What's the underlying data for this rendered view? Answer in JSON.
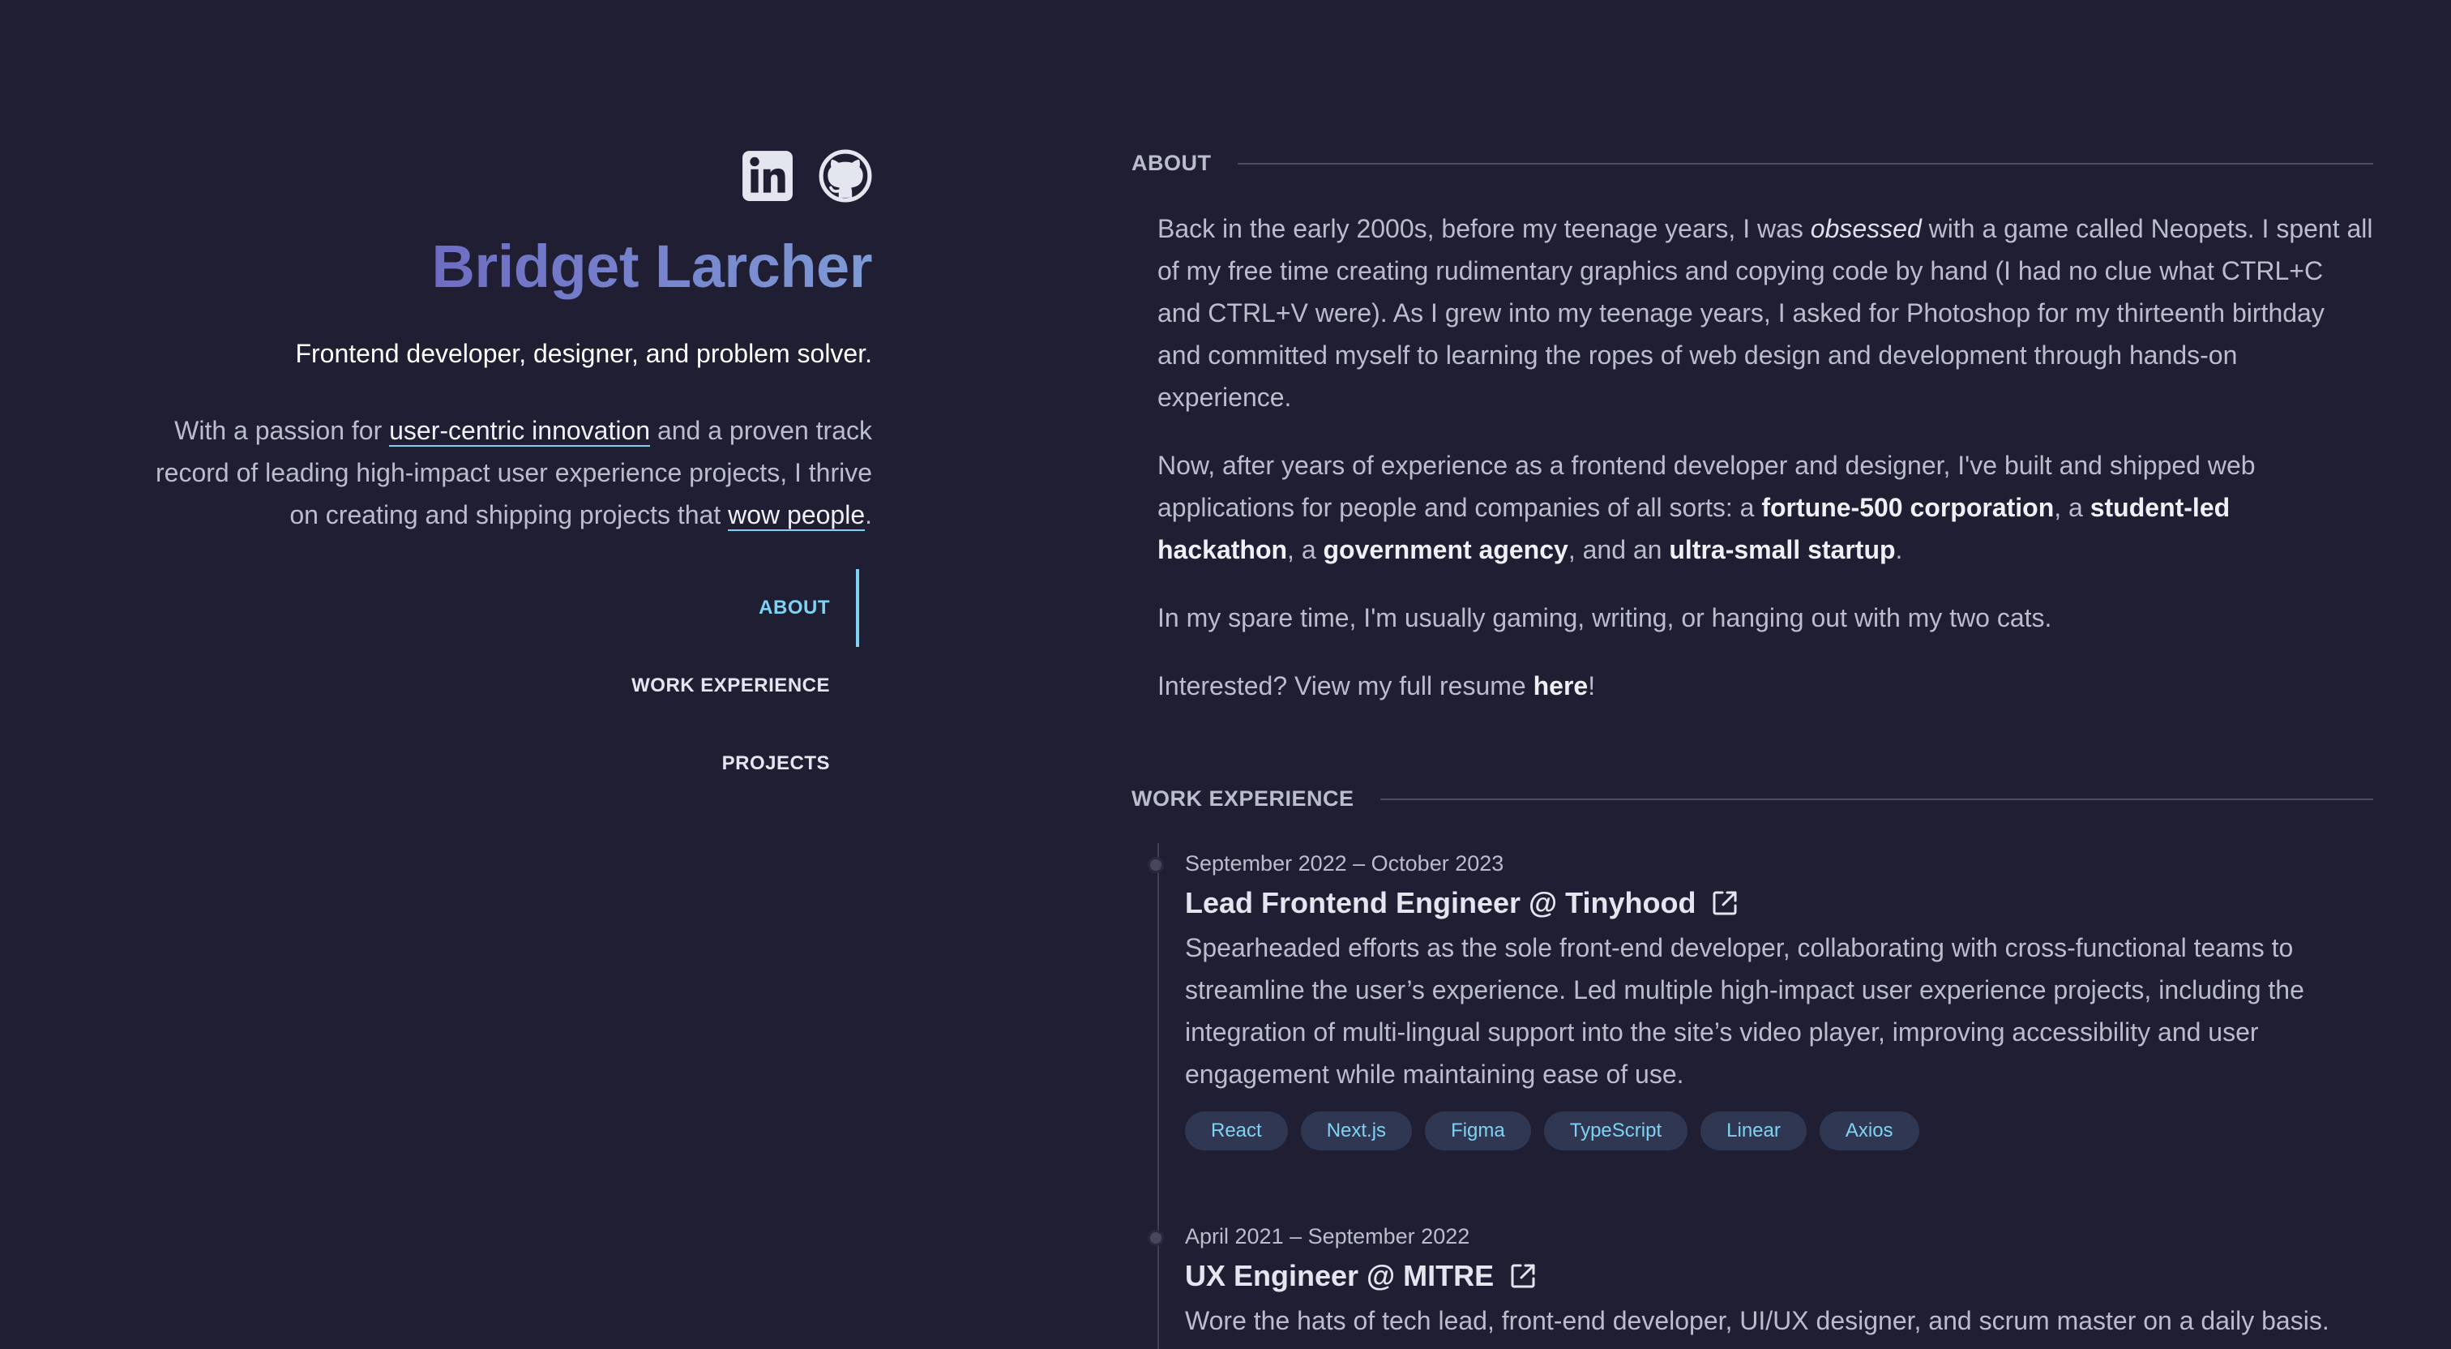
{
  "profile": {
    "name": "Bridget Larcher",
    "tagline": "Frontend developer, designer, and problem solver.",
    "intro": {
      "part1": "With a passion for ",
      "link1": "user-centric innovation",
      "part2": " and a proven track record of leading high-impact user experience projects, I thrive on creating and shipping projects that ",
      "link2": "wow people",
      "part3": "."
    },
    "socials": [
      {
        "icon": "linkedin-icon"
      },
      {
        "icon": "github-icon"
      }
    ]
  },
  "nav": [
    {
      "label": "ABOUT",
      "active": true
    },
    {
      "label": "WORK EXPERIENCE",
      "active": false
    },
    {
      "label": "PROJECTS",
      "active": false
    }
  ],
  "about": {
    "heading": "ABOUT",
    "p1": {
      "a": "Back in the early 2000s, before my teenage years, I was ",
      "em": "obsessed",
      "b": " with a game called Neopets. I spent all of my free time creating rudimentary graphics and copying code by hand (I had no clue what CTRL+C and CTRL+V were). As I grew into my teenage years, I asked for Photoshop for my thirteenth birthday and committed myself to learning the ropes of web design and development through hands-on experience."
    },
    "p2": {
      "a": "Now, after years of experience as a frontend developer and designer, I've built and shipped web applications for people and companies of all sorts: a ",
      "s1": "fortune-500 corporation",
      "b": ", a ",
      "s2": "student-led hackathon",
      "c": ", a ",
      "s3": "government agency",
      "d": ", and an ",
      "s4": "ultra-small startup",
      "e": "."
    },
    "p3": "In my spare time, I'm usually gaming, writing, or hanging out with my two cats.",
    "p4": {
      "a": "Interested? View my full resume ",
      "link": "here",
      "b": "!"
    }
  },
  "experience": {
    "heading": "WORK EXPERIENCE",
    "jobs": [
      {
        "dates": "September 2022 – October 2023",
        "title": "Lead Frontend Engineer @ Tinyhood",
        "description": "Spearheaded efforts as the sole front-end developer, collaborating with cross-functional teams to streamline the user’s experience. Led multiple high-impact user experience projects, including the integration of multi-lingual support into the site’s video player, improving accessibility and user engagement while maintaining ease of use.",
        "tags": [
          "React",
          "Next.js",
          "Figma",
          "TypeScript",
          "Linear",
          "Axios"
        ]
      },
      {
        "dates": "April 2021 – September 2022",
        "title": "UX Engineer @ MITRE",
        "description": "Wore the hats of tech lead, front-end developer, UI/UX designer, and scrum master on a daily basis.",
        "tags": []
      }
    ]
  },
  "colors": {
    "background": "#1f1e33",
    "accent": "#7fd3f2",
    "name_gradient_start": "#6e6cc3",
    "name_gradient_end": "#7f9ad6",
    "tag_background": "#2f3753"
  }
}
